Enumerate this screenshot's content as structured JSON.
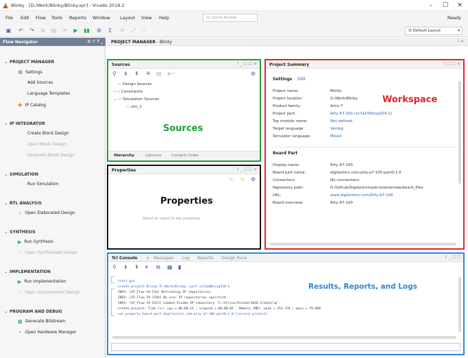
{
  "window": {
    "title": "Blinky - [D:/Work/Blinky/Blinky.xpr] - Vivado 2018.2",
    "controls": [
      "–",
      "☐",
      "✕"
    ]
  },
  "menu": {
    "items": [
      "File",
      "Edit",
      "Flow",
      "Tools",
      "Reports",
      "Window",
      "Layout",
      "View",
      "Help"
    ],
    "quick_access_placeholder": "Q- Quick Access",
    "status": "Ready"
  },
  "toolbar": {
    "layout_select": "Default Layout"
  },
  "flow_navigator": {
    "title": "Flow Navigator",
    "controls": "≡ ÷ ? _",
    "sections": [
      {
        "label": "PROJECT MANAGER",
        "items": [
          {
            "label": "Settings",
            "icon": "gear-icon"
          },
          {
            "label": "Add Sources"
          },
          {
            "label": "Language Templates"
          },
          {
            "label": "IP Catalog",
            "icon": "ip-icon"
          }
        ]
      },
      {
        "label": "IP INTEGRATOR",
        "items": [
          {
            "label": "Create Block Design"
          },
          {
            "label": "Open Block Design",
            "disabled": true
          },
          {
            "label": "Generate Block Design",
            "disabled": true
          }
        ]
      },
      {
        "label": "SIMULATION",
        "items": [
          {
            "label": "Run Simulation"
          }
        ]
      },
      {
        "label": "RTL ANALYSIS",
        "items": [
          {
            "label": "Open Elaborated Design"
          }
        ]
      },
      {
        "label": "SYNTHESIS",
        "items": [
          {
            "label": "Run Synthesis"
          },
          {
            "label": "Open Synthesized Design",
            "disabled": true
          }
        ]
      },
      {
        "label": "IMPLEMENTATION",
        "items": [
          {
            "label": "Run Implementation"
          },
          {
            "label": "Open Implemented Design",
            "disabled": true
          }
        ]
      },
      {
        "label": "PROGRAM AND DEBUG",
        "items": [
          {
            "label": "Generate Bitstream"
          },
          {
            "label": "Open Hardware Manager"
          }
        ]
      }
    ]
  },
  "project_manager": {
    "title": "PROJECT MANAGER",
    "suffix": "- Blinky",
    "controls": "? ✕"
  },
  "sources": {
    "title": "Sources",
    "controls": "? _ ☐ ☐ ✕",
    "toolbar_count": "0",
    "tree": [
      "Design Sources",
      "Constraints",
      "Simulation Sources",
      "sim_1"
    ],
    "annotation": "Sources",
    "tabs": [
      "Hierarchy",
      "Libraries",
      "Compile Order"
    ],
    "accent": "#1e9e3a"
  },
  "properties": {
    "title": "Properties",
    "controls": "? _ ☐ ☐ ✕",
    "annotation": "Properties",
    "empty_text": "Select an object to see properties"
  },
  "summary": {
    "title": "Project Summary",
    "controls": "? ☐ ☐ ✕",
    "settings_label": "Settings",
    "edit_label": "Edit",
    "annotation": "Workspace",
    "settings_rows": [
      {
        "k": "Project name:",
        "v": "Blinky"
      },
      {
        "k": "Project location:",
        "v": "D:/Work/Blinky"
      },
      {
        "k": "Product family:",
        "v": "Artix-7"
      },
      {
        "k": "Project part:",
        "v": "Arty A7-100 (xc7a100tcsg324-1)",
        "link": true
      },
      {
        "k": "Top module name:",
        "v": "Not defined",
        "link": true
      },
      {
        "k": "Target language:",
        "v": "Verilog",
        "link": true
      },
      {
        "k": "Simulator language:",
        "v": "Mixed",
        "link": true
      }
    ],
    "board_label": "Board Part",
    "board_rows": [
      {
        "k": "Display name:",
        "v": "Arty A7-100"
      },
      {
        "k": "Board part name:",
        "v": "digilentinc.com:arty-a7-100:part0:1.0"
      },
      {
        "k": "Connectors:",
        "v": "No connections"
      },
      {
        "k": "Repository path:",
        "v": "D:/Github/Digilent/vivado-boards/new/board_files"
      },
      {
        "k": "URL:",
        "v": "www.digilentinc.com/Arty-A7-100",
        "link": true
      },
      {
        "k": "Board overview:",
        "v": "Arty A7-100"
      }
    ],
    "accent": "#e0242a"
  },
  "console": {
    "tabs": [
      "Tcl Console",
      "Messages",
      "Log",
      "Reports",
      "Design Runs"
    ],
    "controls": "? _ ☐ ☐",
    "annotation": "Results, Reports, and Logs",
    "lines": [
      {
        "text": "start_gui",
        "blue": true
      },
      {
        "text": "create_project Blinky D:/Work/Blinky -part xc7a100tcsg324-1",
        "blue": true
      },
      {
        "text": "INFO: [IP_Flow 19-234] Refreshing IP repositories"
      },
      {
        "text": "INFO: [IP_Flow 19-1704] No user IP repositories specified"
      },
      {
        "text": "INFO: [IP_Flow 19-2313] Loaded Vivado IP repository 'C:/Xilinx/Vivado/2018.2/data/ip'."
      },
      {
        "text": "create_project: Time (s): cpu = 00:00:13 ; elapsed = 00:00:05 . Memory (MB): peak = 353.734 ; gain = 79.908"
      },
      {
        "text": "set_property board_part digilentinc.com:arty-a7-100:part0:1.0 [current_project]",
        "blue": true
      }
    ],
    "accent": "#2f86d6"
  }
}
